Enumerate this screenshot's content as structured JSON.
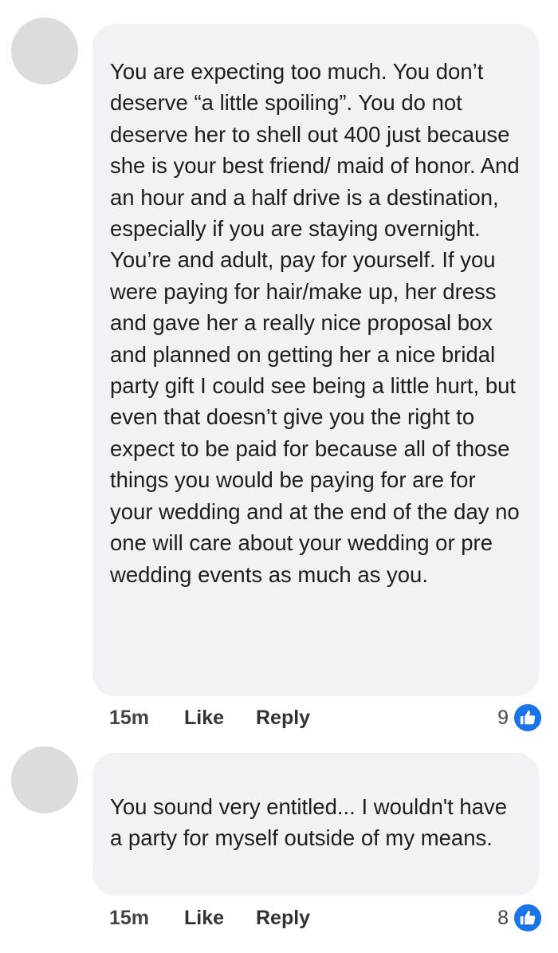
{
  "comments": [
    {
      "text": "You are expecting too much. You don’t deserve “a little spoiling”. You do not deserve her to shell out 400 just because she is your best friend/ maid of honor. And an hour and a half drive is a destination, especially if you are staying overnight. You’re and adult, pay for yourself. If you were paying for hair/make up, her dress and gave her a really nice proposal box and planned on getting her a nice bridal party gift I could see being a little hurt, but even that doesn’t give you the right to expect to be paid for because all of those things you would be paying for are for your wedding and at the end of the day no one will care about your wedding or pre wedding events as much as you.",
      "time": "15m",
      "like_label": "Like",
      "reply_label": "Reply",
      "reaction_count": "9",
      "reaction_icon": "like-icon"
    },
    {
      "text": "You sound very entitled... I wouldn't have a party for myself outside of my means.",
      "time": "15m",
      "like_label": "Like",
      "reply_label": "Reply",
      "reaction_count": "8",
      "reaction_icon": "like-icon"
    }
  ],
  "colors": {
    "bubble_bg": "#f0f2f5",
    "avatar_placeholder": "#dcdcdc",
    "like_blue": "#1a73e8"
  }
}
